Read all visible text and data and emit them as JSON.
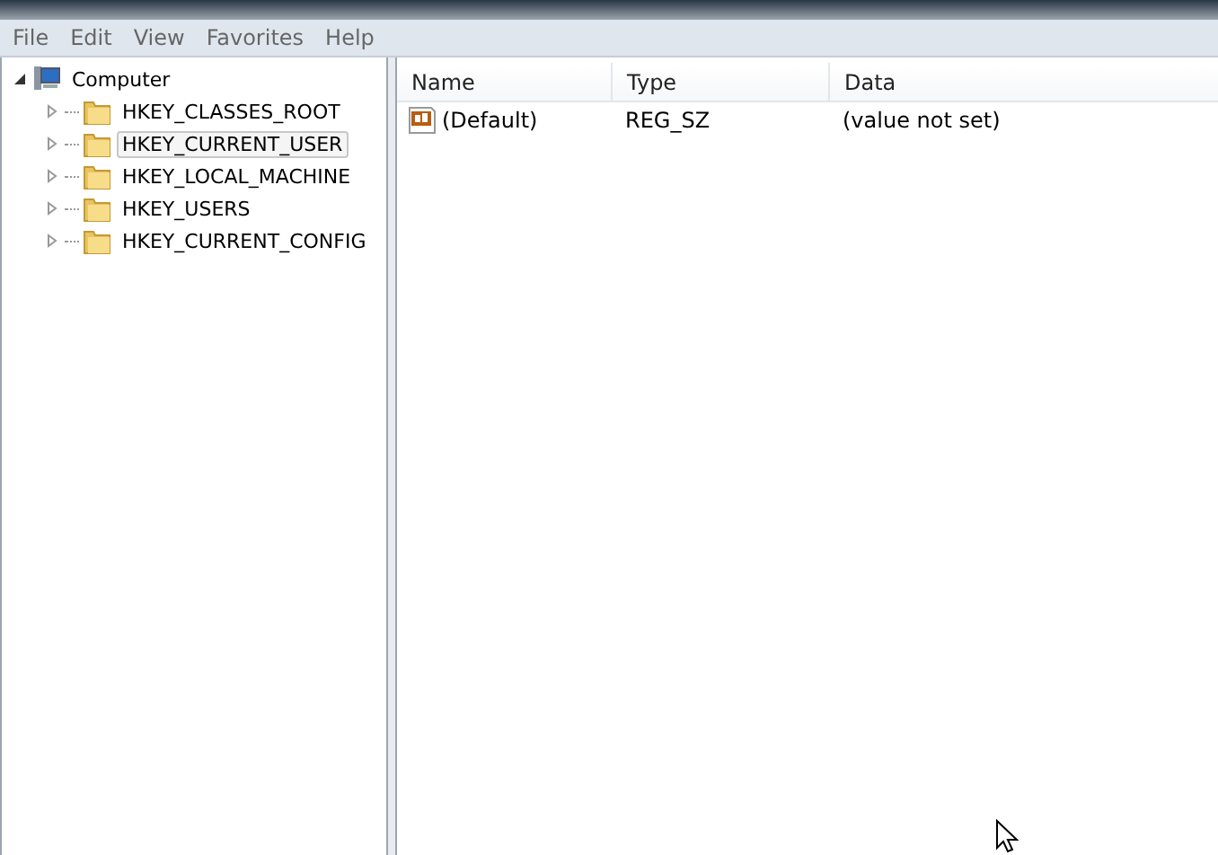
{
  "menu": [
    "File",
    "Edit",
    "View",
    "Favorites",
    "Help"
  ],
  "tree": [
    {
      "label": "Computer",
      "expanded": true,
      "selected": false,
      "children": [
        {
          "label": "HKEY_CLASSES_ROOT",
          "expanded": false,
          "selected": false
        },
        {
          "label": "HKEY_CURRENT_USER",
          "expanded": false,
          "selected": true
        },
        {
          "label": "HKEY_LOCAL_MACHINE",
          "expanded": false,
          "selected": false
        },
        {
          "label": "HKEY_USERS",
          "expanded": false,
          "selected": false
        },
        {
          "label": "HKEY_CURRENT_CONFIG",
          "expanded": false,
          "selected": false
        }
      ]
    }
  ],
  "table": {
    "columns": [
      "Name",
      "Type",
      "Data"
    ],
    "rows": [
      {
        "name": "(Default)",
        "type": "REG_SZ",
        "data": "(value not set)"
      }
    ]
  }
}
